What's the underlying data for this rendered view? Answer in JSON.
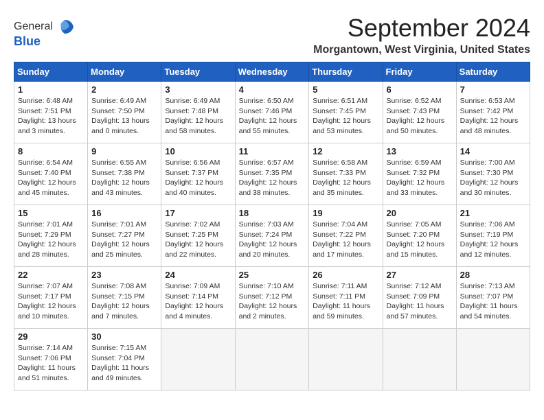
{
  "logo": {
    "general": "General",
    "blue": "Blue"
  },
  "title": "September 2024",
  "location": "Morgantown, West Virginia, United States",
  "headers": [
    "Sunday",
    "Monday",
    "Tuesday",
    "Wednesday",
    "Thursday",
    "Friday",
    "Saturday"
  ],
  "weeks": [
    [
      {
        "day": "1",
        "sunrise": "6:48 AM",
        "sunset": "7:51 PM",
        "daylight": "13 hours and 3 minutes."
      },
      {
        "day": "2",
        "sunrise": "6:49 AM",
        "sunset": "7:50 PM",
        "daylight": "13 hours and 0 minutes."
      },
      {
        "day": "3",
        "sunrise": "6:49 AM",
        "sunset": "7:48 PM",
        "daylight": "12 hours and 58 minutes."
      },
      {
        "day": "4",
        "sunrise": "6:50 AM",
        "sunset": "7:46 PM",
        "daylight": "12 hours and 55 minutes."
      },
      {
        "day": "5",
        "sunrise": "6:51 AM",
        "sunset": "7:45 PM",
        "daylight": "12 hours and 53 minutes."
      },
      {
        "day": "6",
        "sunrise": "6:52 AM",
        "sunset": "7:43 PM",
        "daylight": "12 hours and 50 minutes."
      },
      {
        "day": "7",
        "sunrise": "6:53 AM",
        "sunset": "7:42 PM",
        "daylight": "12 hours and 48 minutes."
      }
    ],
    [
      {
        "day": "8",
        "sunrise": "6:54 AM",
        "sunset": "7:40 PM",
        "daylight": "12 hours and 45 minutes."
      },
      {
        "day": "9",
        "sunrise": "6:55 AM",
        "sunset": "7:38 PM",
        "daylight": "12 hours and 43 minutes."
      },
      {
        "day": "10",
        "sunrise": "6:56 AM",
        "sunset": "7:37 PM",
        "daylight": "12 hours and 40 minutes."
      },
      {
        "day": "11",
        "sunrise": "6:57 AM",
        "sunset": "7:35 PM",
        "daylight": "12 hours and 38 minutes."
      },
      {
        "day": "12",
        "sunrise": "6:58 AM",
        "sunset": "7:33 PM",
        "daylight": "12 hours and 35 minutes."
      },
      {
        "day": "13",
        "sunrise": "6:59 AM",
        "sunset": "7:32 PM",
        "daylight": "12 hours and 33 minutes."
      },
      {
        "day": "14",
        "sunrise": "7:00 AM",
        "sunset": "7:30 PM",
        "daylight": "12 hours and 30 minutes."
      }
    ],
    [
      {
        "day": "15",
        "sunrise": "7:01 AM",
        "sunset": "7:29 PM",
        "daylight": "12 hours and 28 minutes."
      },
      {
        "day": "16",
        "sunrise": "7:01 AM",
        "sunset": "7:27 PM",
        "daylight": "12 hours and 25 minutes."
      },
      {
        "day": "17",
        "sunrise": "7:02 AM",
        "sunset": "7:25 PM",
        "daylight": "12 hours and 22 minutes."
      },
      {
        "day": "18",
        "sunrise": "7:03 AM",
        "sunset": "7:24 PM",
        "daylight": "12 hours and 20 minutes."
      },
      {
        "day": "19",
        "sunrise": "7:04 AM",
        "sunset": "7:22 PM",
        "daylight": "12 hours and 17 minutes."
      },
      {
        "day": "20",
        "sunrise": "7:05 AM",
        "sunset": "7:20 PM",
        "daylight": "12 hours and 15 minutes."
      },
      {
        "day": "21",
        "sunrise": "7:06 AM",
        "sunset": "7:19 PM",
        "daylight": "12 hours and 12 minutes."
      }
    ],
    [
      {
        "day": "22",
        "sunrise": "7:07 AM",
        "sunset": "7:17 PM",
        "daylight": "12 hours and 10 minutes."
      },
      {
        "day": "23",
        "sunrise": "7:08 AM",
        "sunset": "7:15 PM",
        "daylight": "12 hours and 7 minutes."
      },
      {
        "day": "24",
        "sunrise": "7:09 AM",
        "sunset": "7:14 PM",
        "daylight": "12 hours and 4 minutes."
      },
      {
        "day": "25",
        "sunrise": "7:10 AM",
        "sunset": "7:12 PM",
        "daylight": "12 hours and 2 minutes."
      },
      {
        "day": "26",
        "sunrise": "7:11 AM",
        "sunset": "7:11 PM",
        "daylight": "11 hours and 59 minutes."
      },
      {
        "day": "27",
        "sunrise": "7:12 AM",
        "sunset": "7:09 PM",
        "daylight": "11 hours and 57 minutes."
      },
      {
        "day": "28",
        "sunrise": "7:13 AM",
        "sunset": "7:07 PM",
        "daylight": "11 hours and 54 minutes."
      }
    ],
    [
      {
        "day": "29",
        "sunrise": "7:14 AM",
        "sunset": "7:06 PM",
        "daylight": "11 hours and 51 minutes."
      },
      {
        "day": "30",
        "sunrise": "7:15 AM",
        "sunset": "7:04 PM",
        "daylight": "11 hours and 49 minutes."
      },
      null,
      null,
      null,
      null,
      null
    ]
  ]
}
